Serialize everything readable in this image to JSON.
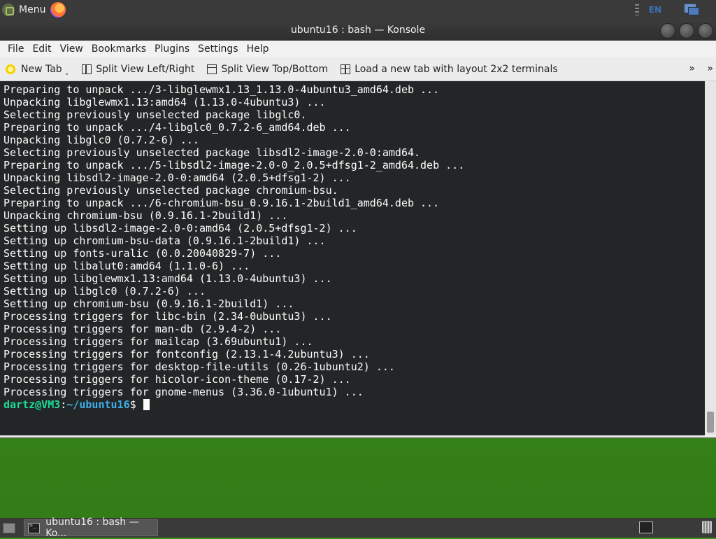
{
  "top_panel": {
    "menu_label": "Menu",
    "lang": "EN",
    "icons": [
      "menu-icon",
      "firefox-icon",
      "network-icon"
    ]
  },
  "window": {
    "title": "ubuntu16 : bash — Konsole",
    "menu": [
      "File",
      "Edit",
      "View",
      "Bookmarks",
      "Plugins",
      "Settings",
      "Help"
    ],
    "toolbar": {
      "new_tab": "New Tab",
      "split_lr": "Split View Left/Right",
      "split_tb": "Split View Top/Bottom",
      "layout_2x2": "Load a new tab with layout 2x2 terminals",
      "overflow": "»"
    }
  },
  "terminal": {
    "lines": [
      "Preparing to unpack .../3-libglewmx1.13_1.13.0-4ubuntu3_amd64.deb ...",
      "Unpacking libglewmx1.13:amd64 (1.13.0-4ubuntu3) ...",
      "Selecting previously unselected package libglc0.",
      "Preparing to unpack .../4-libglc0_0.7.2-6_amd64.deb ...",
      "Unpacking libglc0 (0.7.2-6) ...",
      "Selecting previously unselected package libsdl2-image-2.0-0:amd64.",
      "Preparing to unpack .../5-libsdl2-image-2.0-0_2.0.5+dfsg1-2_amd64.deb ...",
      "Unpacking libsdl2-image-2.0-0:amd64 (2.0.5+dfsg1-2) ...",
      "Selecting previously unselected package chromium-bsu.",
      "Preparing to unpack .../6-chromium-bsu_0.9.16.1-2build1_amd64.deb ...",
      "Unpacking chromium-bsu (0.9.16.1-2build1) ...",
      "Setting up libsdl2-image-2.0-0:amd64 (2.0.5+dfsg1-2) ...",
      "Setting up chromium-bsu-data (0.9.16.1-2build1) ...",
      "Setting up fonts-uralic (0.0.20040829-7) ...",
      "Setting up libalut0:amd64 (1.1.0-6) ...",
      "Setting up libglewmx1.13:amd64 (1.13.0-4ubuntu3) ...",
      "Setting up libglc0 (0.7.2-6) ...",
      "Setting up chromium-bsu (0.9.16.1-2build1) ...",
      "Processing triggers for libc-bin (2.34-0ubuntu3) ...",
      "Processing triggers for man-db (2.9.4-2) ...",
      "Processing triggers for mailcap (3.69ubuntu1) ...",
      "Processing triggers for fontconfig (2.13.1-4.2ubuntu3) ...",
      "Processing triggers for desktop-file-utils (0.26-1ubuntu2) ...",
      "Processing triggers for hicolor-icon-theme (0.17-2) ...",
      "Processing triggers for gnome-menus (3.36.0-1ubuntu1) ..."
    ],
    "prompt_user": "dartz@VM3",
    "prompt_sep": ":",
    "prompt_path": "~/ubuntu16",
    "prompt_symbol": "$ "
  },
  "taskbar": {
    "task_label": "ubuntu16 : bash — Ko..."
  }
}
